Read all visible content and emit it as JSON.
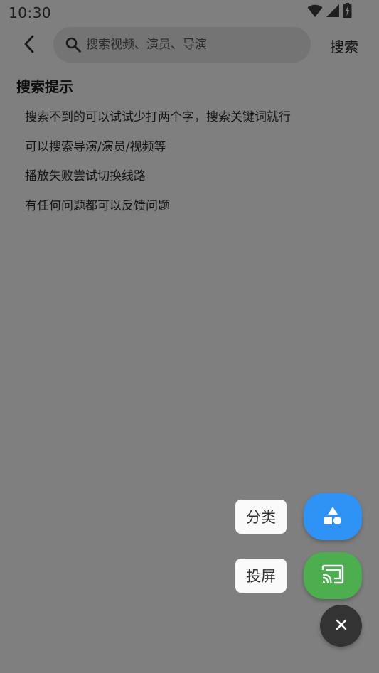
{
  "status_bar": {
    "time": "10:30",
    "icons": [
      "wifi-icon",
      "cellular-signal-icon",
      "battery-charging-icon"
    ]
  },
  "header": {
    "back_icon": "chevron-left-icon",
    "search_placeholder": "搜索视频、演员、导演",
    "search_value": "",
    "search_button_label": "搜索"
  },
  "tips": {
    "title": "搜索提示",
    "items": [
      "搜索不到的可以试试少打两个字，搜索关键词就行",
      "可以搜索导演/演员/视频等",
      "播放失败尝试切换线路",
      "有任何问题都可以反馈问题"
    ]
  },
  "fab_menu": {
    "category_label": "分类",
    "category_icon": "shapes-icon",
    "category_color": "#2f93f5",
    "cast_label": "投屏",
    "cast_icon": "cast-icon",
    "cast_color": "#4cae4f",
    "close_icon": "close-icon",
    "close_color": "#333333"
  },
  "colors": {
    "scrim_background": "#7f7f7f",
    "search_box": "#747474",
    "label_background": "#fafafa"
  }
}
